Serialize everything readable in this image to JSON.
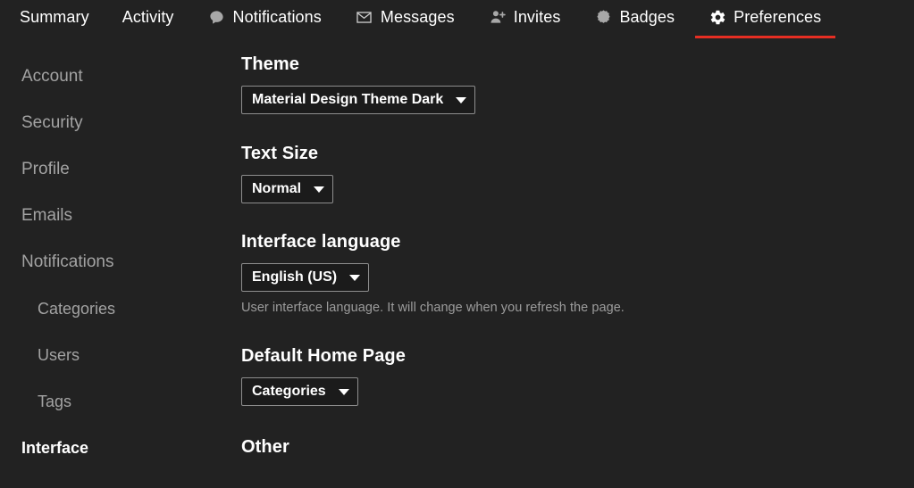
{
  "nav": {
    "items": [
      {
        "label": "Summary",
        "icon": "",
        "active": false
      },
      {
        "label": "Activity",
        "icon": "",
        "active": false
      },
      {
        "label": "Notifications",
        "icon": "speech-bubble-icon",
        "active": false
      },
      {
        "label": "Messages",
        "icon": "envelope-icon",
        "active": false
      },
      {
        "label": "Invites",
        "icon": "user-plus-icon",
        "active": false
      },
      {
        "label": "Badges",
        "icon": "badge-icon",
        "active": false
      },
      {
        "label": "Preferences",
        "icon": "gear-icon",
        "active": true
      }
    ],
    "active_accent": "#e62e23"
  },
  "sidebar": {
    "items": [
      {
        "label": "Account",
        "sub": false,
        "active": false
      },
      {
        "label": "Security",
        "sub": false,
        "active": false
      },
      {
        "label": "Profile",
        "sub": false,
        "active": false
      },
      {
        "label": "Emails",
        "sub": false,
        "active": false
      },
      {
        "label": "Notifications",
        "sub": false,
        "active": false
      },
      {
        "label": "Categories",
        "sub": true,
        "active": false
      },
      {
        "label": "Users",
        "sub": true,
        "active": false
      },
      {
        "label": "Tags",
        "sub": true,
        "active": false
      },
      {
        "label": "Interface",
        "sub": false,
        "active": true
      }
    ]
  },
  "content": {
    "theme": {
      "title": "Theme",
      "value": "Material Design Theme Dark"
    },
    "text_size": {
      "title": "Text Size",
      "value": "Normal"
    },
    "interface_language": {
      "title": "Interface language",
      "value": "English (US)",
      "help": "User interface language. It will change when you refresh the page."
    },
    "default_home_page": {
      "title": "Default Home Page",
      "value": "Categories"
    },
    "other": {
      "title": "Other"
    }
  },
  "colors": {
    "background": "#222222",
    "accent_red": "#e62e23",
    "text_primary": "#ffffff",
    "text_muted": "#a3a3a3",
    "select_border": "#8e8e8e",
    "select_bg": "#1b1b1b"
  }
}
